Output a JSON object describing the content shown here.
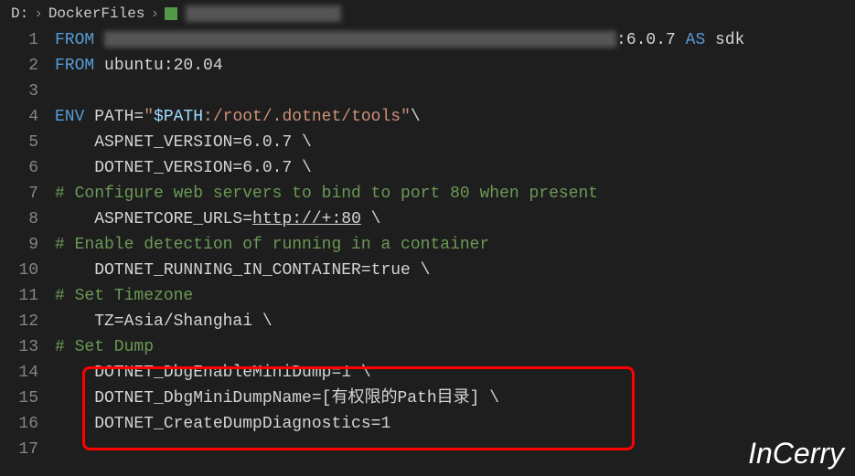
{
  "breadcrumb": {
    "drive": "D:",
    "folder": "DockerFiles",
    "sep": "›"
  },
  "code": {
    "l1_from": "FROM ",
    "l1_tag": ":6.0.7 ",
    "l1_as": "AS",
    "l1_sdk": " sdk",
    "l2_from": "FROM",
    "l2_img": " ubuntu:20.04",
    "l4_env": "ENV",
    "l4_path": " PATH=",
    "l4_q1": "\"",
    "l4_var": "$PATH",
    "l4_rest": ":/root/.dotnet/tools\"",
    "l4_bs": "\\",
    "l5": "    ASPNET_VERSION=6.0.7 \\",
    "l6": "    DOTNET_VERSION=6.0.7 \\",
    "l7": "# Configure web servers to bind to port 80 when present",
    "l8_a": "    ASPNETCORE_URLS=",
    "l8_b": "http://+:80",
    "l8_c": " \\",
    "l9": "# Enable detection of running in a container",
    "l10": "    DOTNET_RUNNING_IN_CONTAINER=true \\",
    "l11": "# Set Timezone",
    "l12": "    TZ=Asia/Shanghai \\",
    "l13": "# Set Dump",
    "l14": "    DOTNET_DbgEnableMiniDump=1 \\",
    "l15": "    DOTNET_DbgMiniDumpName=[有权限的Path目录] \\",
    "l16": "    DOTNET_CreateDumpDiagnostics=1"
  },
  "lines": [
    "1",
    "2",
    "3",
    "4",
    "5",
    "6",
    "7",
    "8",
    "9",
    "10",
    "11",
    "12",
    "13",
    "14",
    "15",
    "16",
    "17"
  ],
  "watermark": "InCerry"
}
